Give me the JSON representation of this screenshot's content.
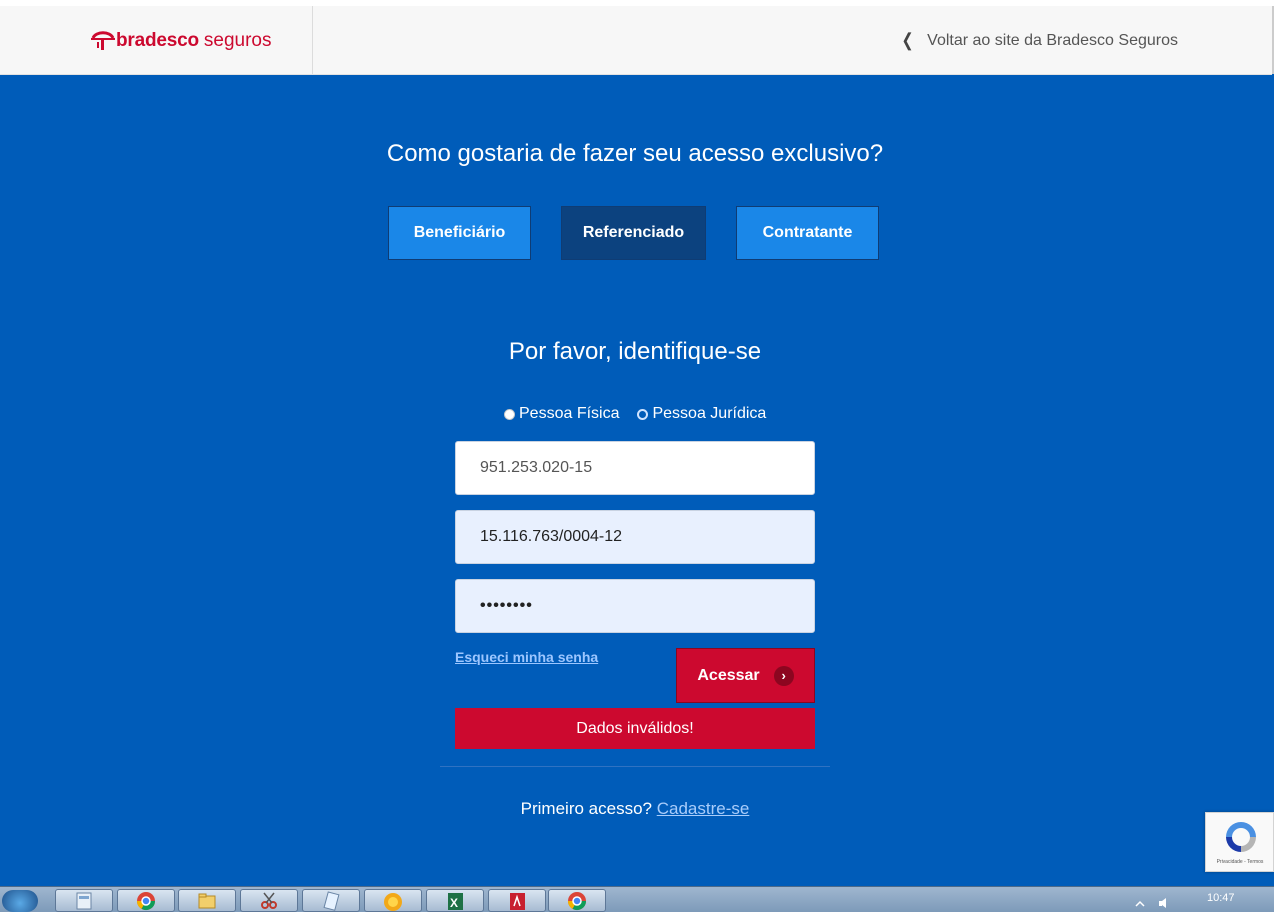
{
  "header": {
    "brand_bold": "bradesco",
    "brand_light": "seguros",
    "back_link": "Voltar ao site da Bradesco Seguros"
  },
  "access": {
    "question": "Como gostaria de fazer seu acesso exclusivo?",
    "tabs": [
      {
        "label": "Beneficiário",
        "active": false
      },
      {
        "label": "Referenciado",
        "active": true
      },
      {
        "label": "Contratante",
        "active": false
      }
    ]
  },
  "login": {
    "title": "Por favor, identifique-se",
    "radio_pf": "Pessoa Física",
    "radio_pj": "Pessoa Jurídica",
    "field_cpf": "951.253.020-15",
    "field_cnpj": "15.116.763/0004-12",
    "field_password": "••••••••",
    "forgot_link": "Esqueci minha senha",
    "submit_label": "Acessar",
    "error_message": "Dados inválidos!",
    "first_access_text": "Primeiro acesso?",
    "register_link": "Cadastre-se"
  },
  "recaptcha": {
    "terms": "Privacidade - Termos"
  },
  "taskbar": {
    "clock": "10:47",
    "apps": [
      "explorer",
      "chrome",
      "folder",
      "snipping-tool",
      "notepad",
      "chrome-canary",
      "excel",
      "acrobat",
      "chrome"
    ]
  },
  "colors": {
    "background": "#005cb9",
    "brand_red": "#cc092f",
    "tab": "#1a87e8",
    "tab_active": "#0c427f"
  }
}
